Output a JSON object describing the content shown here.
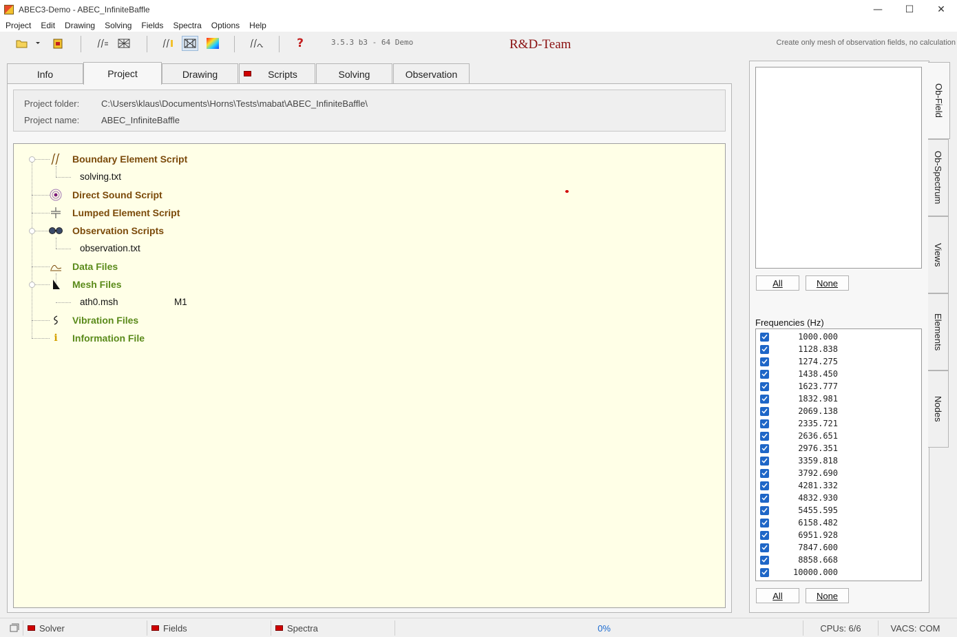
{
  "window": {
    "title": "ABEC3-Demo - ABEC_InfiniteBaffle",
    "controls": {
      "minimize": "—",
      "maximize": "☐",
      "close": "✕"
    }
  },
  "menu": [
    "Project",
    "Edit",
    "Drawing",
    "Solving",
    "Fields",
    "Spectra",
    "Options",
    "Help"
  ],
  "toolbar": {
    "version": "3.5.3 b3 - 64 Demo",
    "team": "R&D-Team",
    "hint": "Create only mesh of observation fields, no calculation"
  },
  "tabs": [
    "Info",
    "Project",
    "Drawing",
    "Scripts",
    "Solving",
    "Observation"
  ],
  "project": {
    "folder_label": "Project folder:",
    "folder_value": "C:\\Users\\klaus\\Documents\\Horns\\Tests\\mabat\\ABEC_InfiniteBaffle\\",
    "name_label": "Project name:",
    "name_value": "ABEC_InfiniteBaffle"
  },
  "tree": {
    "bem": {
      "label": "Boundary Element Script",
      "children": [
        "solving.txt"
      ]
    },
    "direct": {
      "label": "Direct Sound Script"
    },
    "lumped": {
      "label": "Lumped Element Script"
    },
    "observation": {
      "label": "Observation Scripts",
      "children": [
        "observation.txt"
      ]
    },
    "data": {
      "label": "Data Files"
    },
    "mesh": {
      "label": "Mesh Files",
      "children": [
        {
          "name": "ath0.msh",
          "tag": "M1"
        }
      ]
    },
    "vibration": {
      "label": "Vibration Files"
    },
    "information": {
      "label": "Information File"
    }
  },
  "right_panel": {
    "all_label": "All",
    "none_label": "None",
    "freq_title": "Frequencies  (Hz)",
    "frequencies": [
      "1000.000",
      "1128.838",
      "1274.275",
      "1438.450",
      "1623.777",
      "1832.981",
      "2069.138",
      "2335.721",
      "2636.651",
      "2976.351",
      "3359.818",
      "3792.690",
      "4281.332",
      "4832.930",
      "5455.595",
      "6158.482",
      "6951.928",
      "7847.600",
      "8858.668",
      "10000.000"
    ]
  },
  "side_tabs": [
    "Ob-Field",
    "Ob-Spectrum",
    "Views",
    "Elements",
    "Nodes"
  ],
  "statusbar": {
    "solver": "Solver",
    "fields": "Fields",
    "spectra": "Spectra",
    "progress": "0%",
    "cpus": "CPUs: 6/6",
    "vacs": "VACS: COM"
  }
}
